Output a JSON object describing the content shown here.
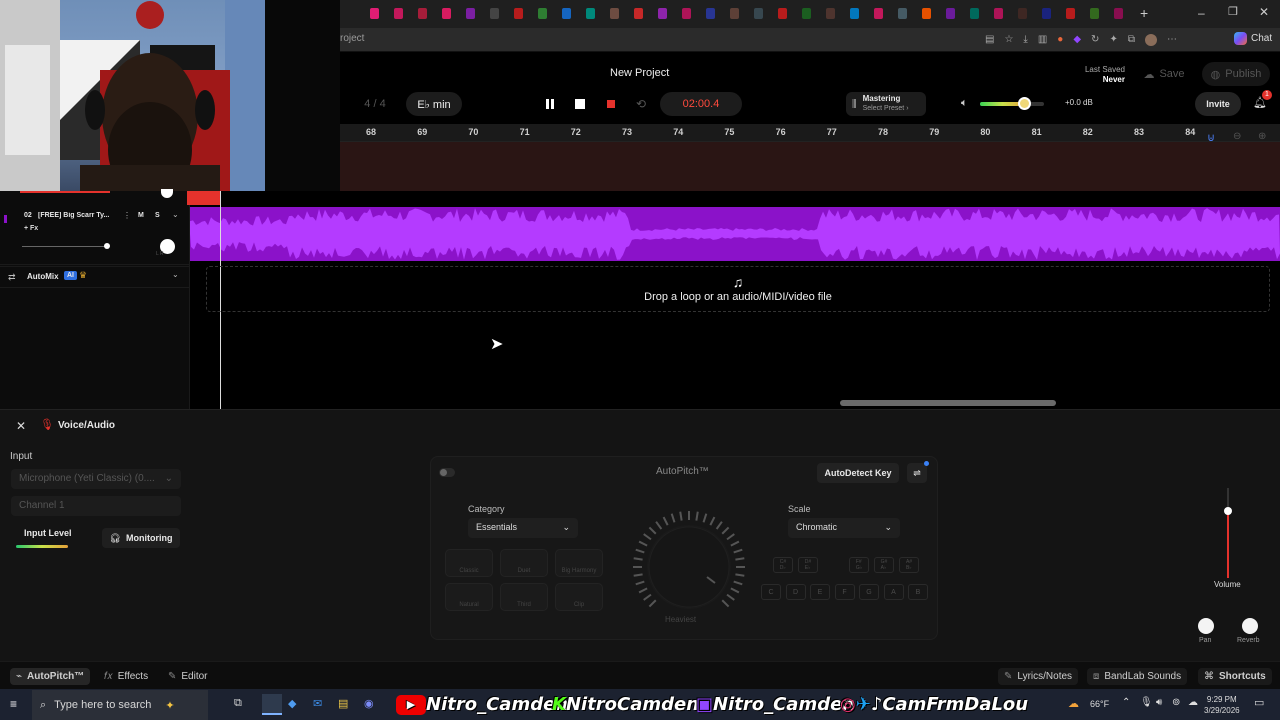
{
  "browser": {
    "url_fragment": "roject",
    "chat_label": "Chat",
    "tab_colors": [
      "#e11d74",
      "#c2185b",
      "#a61d3a",
      "#d81b60",
      "#7b1fa2",
      "#444",
      "#b71c1c",
      "#2e7d32",
      "#1565c0",
      "#00897b",
      "#6d4c41",
      "#c62828",
      "#8e24aa",
      "#ad1457",
      "#283593",
      "#5d4037",
      "#37474f",
      "#b71c1c",
      "#1b5e20",
      "#4e342e",
      "#0277bd",
      "#c2185b",
      "#455a64",
      "#e65100",
      "#6a1b9a",
      "#00695c",
      "#ad1457",
      "#3e2723",
      "#1a237e",
      "#b71c1c",
      "#33691e",
      "#880e4f"
    ]
  },
  "header": {
    "project_title": "New Project",
    "time_signature": "4 / 4",
    "key": "E♭ min",
    "time_display": "02:00.4",
    "mastering_label": "Mastering",
    "mastering_sub": "Select Preset",
    "mastering_arrow": "›",
    "volume_db": "+0.0 dB",
    "last_saved_label": "Last Saved",
    "last_saved_value": "Never",
    "save_label": "Save",
    "publish_label": "Publish",
    "invite_label": "Invite",
    "notification_count": "1",
    "volume_level": 0.7
  },
  "ruler": {
    "bars": [
      "68",
      "69",
      "70",
      "71",
      "72",
      "73",
      "74",
      "75",
      "76",
      "77",
      "78",
      "79",
      "80",
      "81",
      "82",
      "83",
      "84"
    ]
  },
  "tracks": [
    {
      "number": "02",
      "name": "[FREE] Big Scarr Ty...",
      "mute": "M",
      "solo": "S",
      "fx": "+ Fx",
      "lr": "L R"
    }
  ],
  "automix": {
    "label": "AutoMix",
    "badge": "AI"
  },
  "dropzone": {
    "text": "Drop a loop or an audio/MIDI/video file"
  },
  "panel": {
    "title": "Voice/Audio",
    "input_label": "Input",
    "input_device": "Microphone (Yeti Classic) (0....",
    "channel": "Channel 1",
    "input_level_label": "Input Level",
    "monitoring_label": "Monitoring",
    "autopitch": {
      "title": "AutoPitch™",
      "autodetect_label": "AutoDetect Key",
      "category_label": "Category",
      "category_value": "Essentials",
      "scale_label": "Scale",
      "scale_value": "Chromatic",
      "knob_label": "Heaviest",
      "presets": [
        "Classic",
        "Duet",
        "Big Harmony",
        "Natural",
        "Third",
        "Clip"
      ],
      "chord_keys": [
        "C#\nD♭",
        "D#\nE♭",
        "F#\nG♭",
        "G#\nA♭",
        "A#\nB♭"
      ],
      "natural_keys": [
        "C",
        "D",
        "E",
        "F",
        "G",
        "A",
        "B"
      ]
    },
    "volume_label": "Volume",
    "pan_label": "Pan",
    "reverb_label": "Reverb"
  },
  "bottombar": {
    "autopitch_tab": "AutoPitch™",
    "effects_tab": "Effects",
    "editor_tab": "Editor",
    "lyrics_label": "Lyrics/Notes",
    "sounds_label": "BandLab Sounds",
    "shortcuts_label": "Shortcuts"
  },
  "taskbar": {
    "search_placeholder": "Type here to search",
    "social_youtube": "Nitro_Camden",
    "social_kick": "NitroCamden",
    "social_twitch": "Nitro_Camden",
    "social_other": "CamFrmDaLou",
    "weather": "66°F",
    "time": "9:29 PM",
    "date": "3/29/2026"
  },
  "colors": {
    "accent_purple": "#8b12c9",
    "record_red": "#e5322c",
    "time_red": "#ff4a3d"
  }
}
